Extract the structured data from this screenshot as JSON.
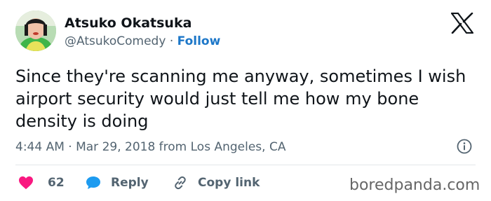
{
  "author": {
    "name": "Atsuko Okatsuka",
    "handle": "@AtsukoComedy",
    "separator": "·",
    "follow_label": "Follow"
  },
  "tweet": {
    "text": "Since they're scanning me anyway, sometimes I wish airport security would just tell me how my bone density is doing",
    "timestamp": "4:44 AM · Mar 29, 2018 from Los Angeles, CA"
  },
  "actions": {
    "like_count": "62",
    "reply_label": "Reply",
    "copy_link_label": "Copy link"
  },
  "watermark": "boredpanda.com",
  "icons": {
    "platform": "x-logo-icon",
    "info": "info-icon",
    "like": "heart-icon",
    "reply": "speech-bubble-icon",
    "copy": "link-icon"
  },
  "colors": {
    "follow": "#1d77c8",
    "heart": "#f91880",
    "reply_bubble": "#1d9bf0",
    "secondary_text": "#536471"
  }
}
